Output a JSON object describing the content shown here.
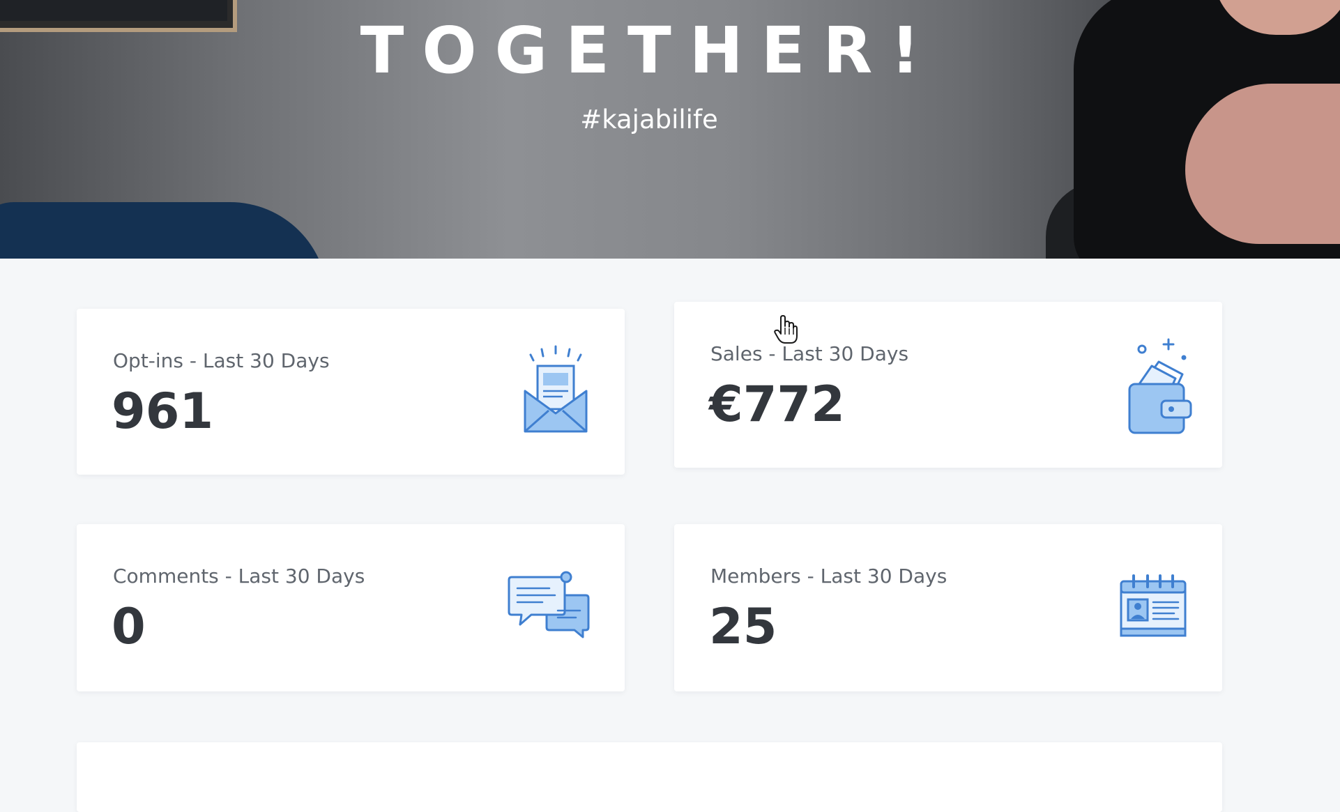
{
  "hero": {
    "title": "TOGETHER!",
    "subtitle": "#kajabilife"
  },
  "stats": {
    "optins": {
      "label": "Opt-ins - Last 30 Days",
      "value": "961",
      "icon": "envelope-newsletter-icon"
    },
    "sales": {
      "label": "Sales - Last 30 Days",
      "value": "€772",
      "icon": "wallet-icon"
    },
    "comments": {
      "label": "Comments - Last 30 Days",
      "value": "0",
      "icon": "chat-bubbles-icon"
    },
    "members": {
      "label": "Members - Last 30 Days",
      "value": "25",
      "icon": "calendar-contact-icon"
    }
  },
  "colors": {
    "icon_stroke": "#3f7fd0",
    "icon_fill": "#9cc6f2",
    "text_value": "#33373d",
    "text_label": "#5f656d",
    "page_bg": "#f5f7f9"
  }
}
